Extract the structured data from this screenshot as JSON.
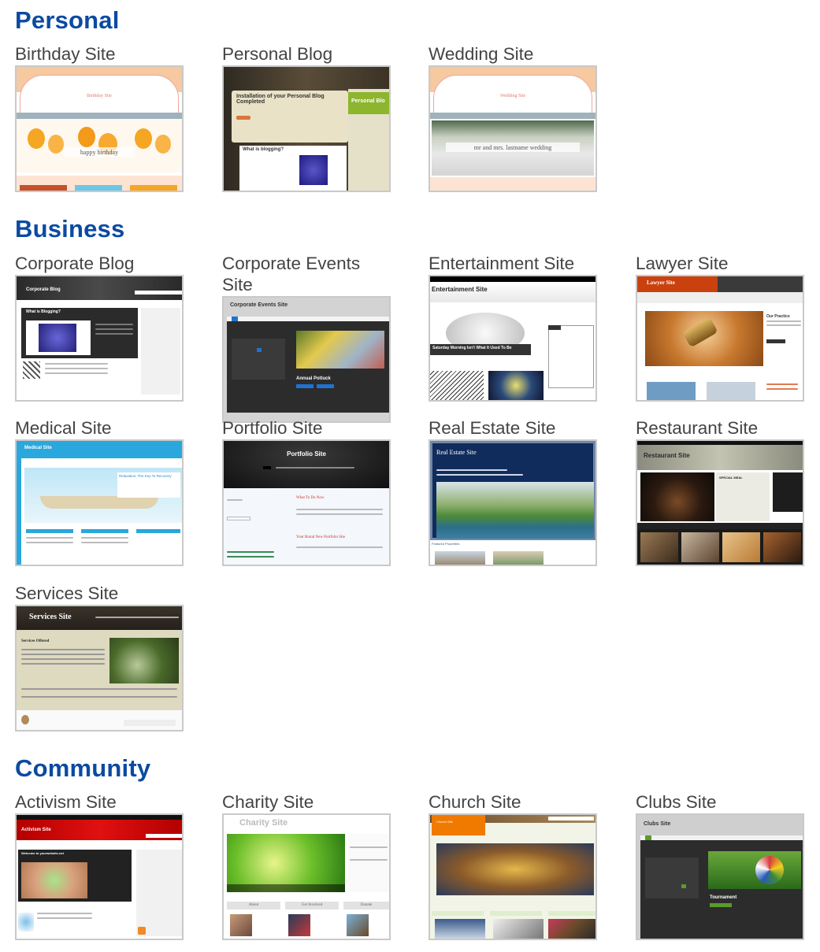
{
  "sections": [
    {
      "title": "Personal",
      "items": [
        {
          "label": "Birthday Site",
          "thumb_title": "Birthday Site",
          "thumb_caption": "happy birthday"
        },
        {
          "label": "Personal Blog",
          "thumb_title": "Installation of your Personal Blog Completed",
          "thumb_sub": "What is blogging?",
          "thumb_side": "Personal Blo"
        },
        {
          "label": "Wedding Site",
          "thumb_title": "Wedding Site",
          "thumb_caption": "mr and mrs. lastname wedding"
        }
      ]
    },
    {
      "title": "Business",
      "items": [
        {
          "label": "Corporate Blog",
          "thumb_title": "Corporate Blog",
          "thumb_sub": "What is Blogging?"
        },
        {
          "label": "Corporate Events Site",
          "thumb_title": "Corporate Events Site",
          "thumb_sub": "Annual Potluck"
        },
        {
          "label": "Entertainment Site",
          "thumb_title": "Entertainment Site",
          "thumb_sub": "Saturday Morning Isn't What It Used To Be"
        },
        {
          "label": "Lawyer Site",
          "thumb_title": "Lawyer Site",
          "thumb_sub": "Our Practice"
        },
        {
          "label": "Medical Site",
          "thumb_title": "Medical Site",
          "thumb_sub": "Relaxation: The Key To Recovery"
        },
        {
          "label": "Portfolio Site",
          "thumb_title": "Portfolio Site",
          "thumb_sub": "What To Do Now",
          "thumb_sub2": "Your Brand New Portfolio Site"
        },
        {
          "label": "Real Estate Site",
          "thumb_title": "Real Estate Site",
          "thumb_sub": "Featured Properties"
        },
        {
          "label": "Restaurant Site",
          "thumb_title": "Restaurant Site",
          "thumb_sub": "SPECIAL MEAL"
        },
        {
          "label": "Services Site",
          "thumb_title": "Services Site",
          "thumb_sub": "Services Offered"
        }
      ]
    },
    {
      "title": "Community",
      "items": [
        {
          "label": "Activism Site",
          "thumb_title": "Activism Site",
          "thumb_sub": "Welcome to yourwebsite.net"
        },
        {
          "label": "Charity Site",
          "thumb_title": "Charity Site",
          "thumb_tabs": [
            "About",
            "Get Involved",
            "Donate"
          ]
        },
        {
          "label": "Church Site",
          "thumb_title": "Church Site"
        },
        {
          "label": "Clubs Site",
          "thumb_title": "Clubs Site",
          "thumb_sub": "Tournament"
        }
      ]
    }
  ],
  "colors": {
    "section_heading": "#0b4aa1",
    "item_label": "#444444",
    "thumb_border": "#c9c9c9"
  }
}
